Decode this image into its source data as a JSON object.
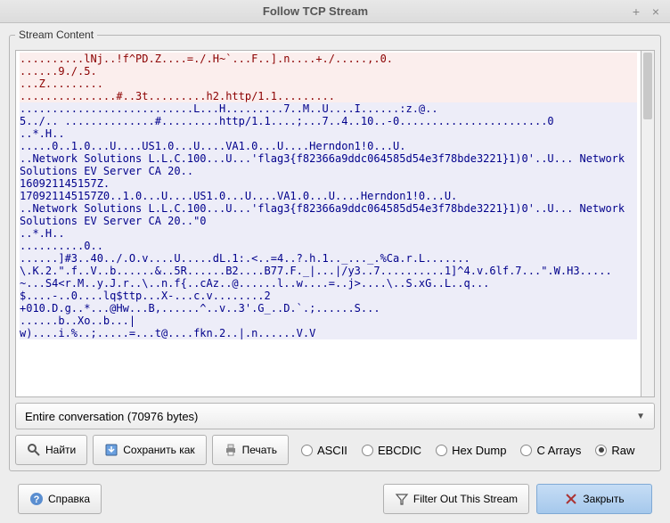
{
  "window": {
    "title": "Follow TCP Stream"
  },
  "fieldset": {
    "legend": "Stream Content"
  },
  "stream": {
    "lines": [
      {
        "cls": "r",
        "text": "..........lNj..!f^PD.Z....=./.H~`...F..].n....+./.....,.0."
      },
      {
        "cls": "r",
        "text": "......9./.5."
      },
      {
        "cls": "r",
        "text": "...Z........."
      },
      {
        "cls": "r",
        "text": "...............#..3t.........h2.http/1.1........."
      },
      {
        "cls": "b",
        "text": "...........................L...H.........7..M..U....I......:z.@.."
      },
      {
        "cls": "b",
        "text": "5../.. ..............#.........http/1.1....;...7..4..10..-0.......................0"
      },
      {
        "cls": "b",
        "text": "..*.H.."
      },
      {
        "cls": "b",
        "text": ".....0..1.0...U....US1.0...U....VA1.0...U....Herndon1!0...U."
      },
      {
        "cls": "b",
        "text": "..Network Solutions L.L.C.100...U...'flag3{f82366a9ddc064585d54e3f78bde3221}1)0'..U... Network Solutions EV Server CA 20.."
      },
      {
        "cls": "b",
        "text": "160921145157Z."
      },
      {
        "cls": "b",
        "text": "170921145157Z0..1.0...U....US1.0...U....VA1.0...U....Herndon1!0...U."
      },
      {
        "cls": "b",
        "text": "..Network Solutions L.L.C.100...U...'flag3{f82366a9ddc064585d54e3f78bde3221}1)0'..U... Network Solutions EV Server CA 20..\"0"
      },
      {
        "cls": "b",
        "text": "..*.H.."
      },
      {
        "cls": "b",
        "text": "..........0.."
      },
      {
        "cls": "b",
        "text": "......]#3..40../.O.v....U.....dL.1:.<..=4..?.h.1.._..._.%Ca.r.L......."
      },
      {
        "cls": "b",
        "text": "\\.K.2.\".f..V..b......&..5R......B2....B77.F._|...|/y3..7..........1]^4.v.6lf.7...\".W.H3.....~...S4<r.M..y.J.r..\\..n.f{..cAz..@......l..w....=..j>....\\..S.xG..L..q..."
      },
      {
        "cls": "b",
        "text": "$....-..0....lq$ttp...X-...c.v........2"
      },
      {
        "cls": "b",
        "text": "+010.D.g..*...@Hw...B,......^..v..3'.G_..D.`.;......S..."
      },
      {
        "cls": "b",
        "text": "......b..Xo..b...|"
      },
      {
        "cls": "b",
        "text": "w)....i.%..;.....=...t@....fkn.2..|.n......V.V"
      }
    ]
  },
  "combo": {
    "label": "Entire conversation (70976 bytes)"
  },
  "buttons": {
    "find": "Найти",
    "saveas": "Сохранить как",
    "print": "Печать",
    "help": "Справка",
    "filterout": "Filter Out This Stream",
    "close": "Закрыть"
  },
  "radios": {
    "ascii": "ASCII",
    "ebcdic": "EBCDIC",
    "hexdump": "Hex Dump",
    "carrays": "C Arrays",
    "raw": "Raw",
    "selected": "raw"
  }
}
